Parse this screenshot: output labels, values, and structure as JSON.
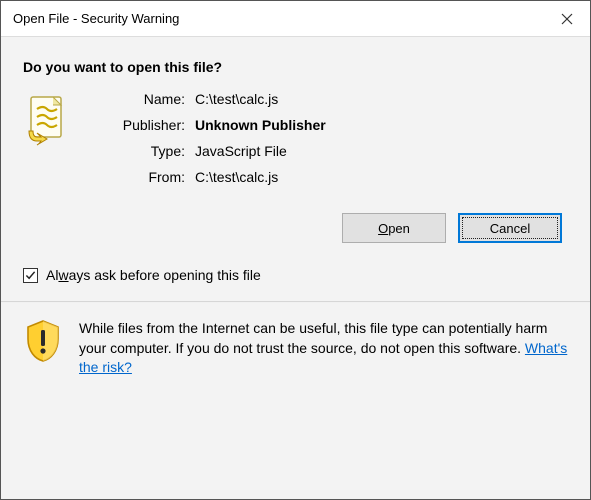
{
  "window": {
    "title": "Open File - Security Warning"
  },
  "main": {
    "question": "Do you want to open this file?",
    "labels": {
      "name": "Name:",
      "publisher": "Publisher:",
      "type": "Type:",
      "from": "From:"
    },
    "values": {
      "name": "C:\\test\\calc.js",
      "publisher": "Unknown Publisher",
      "type": "JavaScript File",
      "from": "C:\\test\\calc.js"
    }
  },
  "buttons": {
    "open_pre": "",
    "open_u": "O",
    "open_post": "pen",
    "cancel": "Cancel"
  },
  "always": {
    "pre": "Al",
    "u": "w",
    "post": "ays ask before opening this file"
  },
  "footer": {
    "text": "While files from the Internet can be useful, this file type can potentially harm your computer. If you do not trust the source, do not open this software. ",
    "link": "What's the risk?"
  }
}
